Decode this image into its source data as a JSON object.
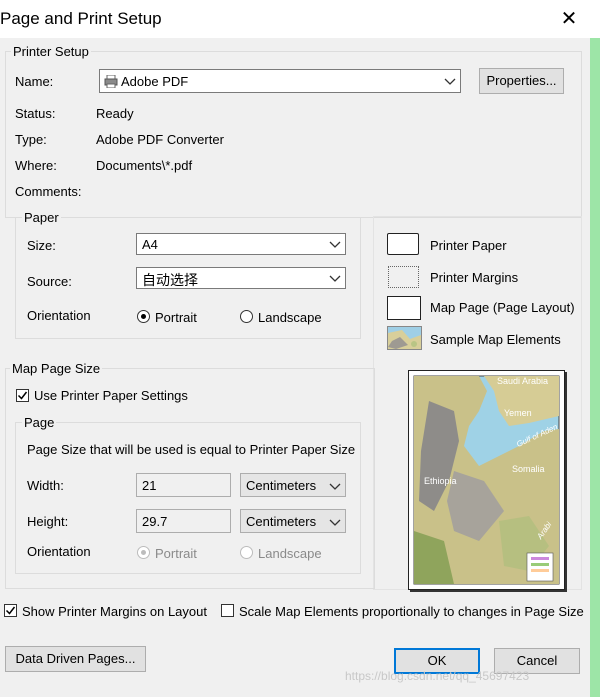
{
  "dialog": {
    "title": "Page and Print Setup",
    "close_glyph": "✕"
  },
  "printer_setup": {
    "legend": "Printer Setup",
    "name_label": "Name:",
    "name_value": "Adobe PDF",
    "properties_label": "Properties...",
    "status_label": "Status:",
    "status_value": "Ready",
    "type_label": "Type:",
    "type_value": "Adobe PDF Converter",
    "where_label": "Where:",
    "where_value": "Documents\\*.pdf",
    "comments_label": "Comments:"
  },
  "paper": {
    "legend": "Paper",
    "size_label": "Size:",
    "size_value": "A4",
    "source_label": "Source:",
    "source_value": "自动选择",
    "orientation_label": "Orientation",
    "portrait_label": "Portrait",
    "landscape_label": "Landscape",
    "selected": "Portrait"
  },
  "legend_panel": {
    "items": [
      "Printer Paper",
      "Printer Margins",
      "Map Page (Page Layout)",
      "Sample Map Elements"
    ]
  },
  "map_page_size": {
    "legend": "Map Page Size",
    "use_printer_label": "Use Printer Paper Settings",
    "use_printer_checked": true,
    "page_legend": "Page",
    "page_note": "Page Size that will be used is equal to Printer Paper Size",
    "width_label": "Width:",
    "width_value": "21",
    "width_unit": "Centimeters",
    "height_label": "Height:",
    "height_value": "29.7",
    "height_unit": "Centimeters",
    "orientation_label": "Orientation",
    "portrait_label": "Portrait",
    "landscape_label": "Landscape",
    "selected": "Portrait"
  },
  "map_preview": {
    "labels": [
      "Saudi Arabia",
      "Yemen",
      "Gulf of Aden",
      "Somalia",
      "Ethiopia",
      "Arabi"
    ]
  },
  "options": {
    "show_margins_label": "Show Printer Margins on Layout",
    "show_margins_checked": true,
    "scale_elements_label": "Scale Map Elements proportionally to changes in Page Size",
    "scale_elements_checked": false
  },
  "footer": {
    "data_driven_label": "Data Driven Pages...",
    "ok_label": "OK",
    "cancel_label": "Cancel",
    "watermark": "https://blog.csdn.net/qq_45697423"
  }
}
